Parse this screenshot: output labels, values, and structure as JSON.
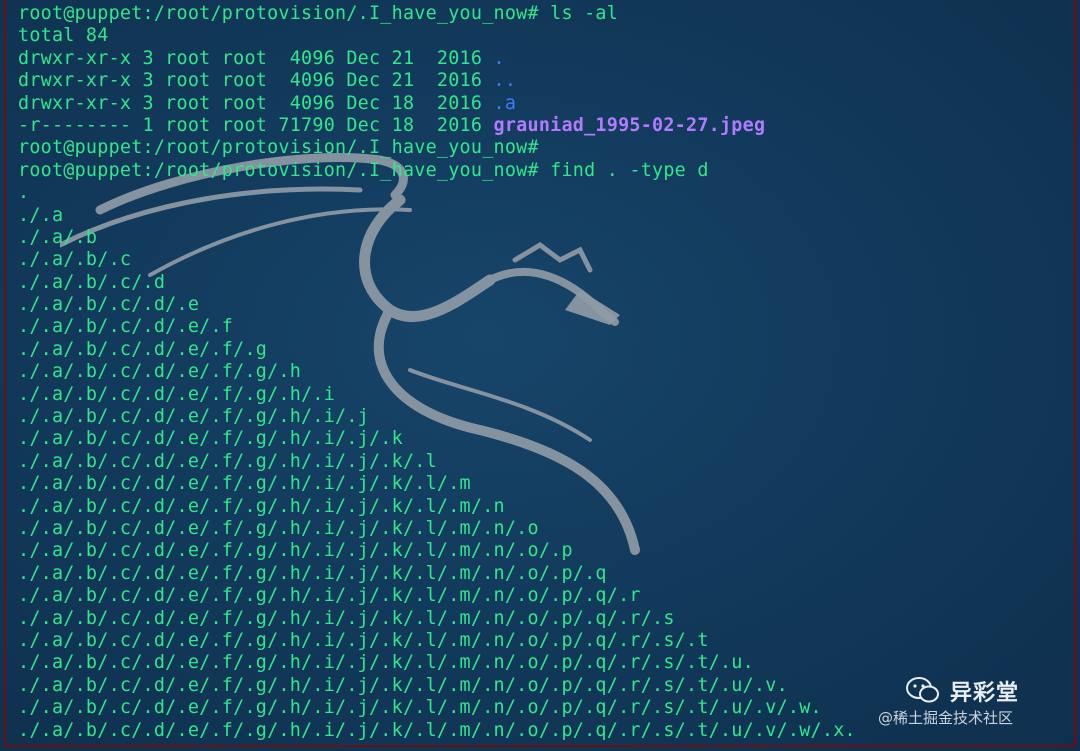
{
  "terminal": {
    "lines": [
      {
        "text": "root@puppet:/root/protovision/.I_have_you_now# ls -al"
      },
      {
        "text": "total 84"
      },
      {
        "text": "drwxr-xr-x 3 root root  4096 Dec 21  2016 ",
        "name": ".",
        "color": "#3d7dff"
      },
      {
        "text": "drwxr-xr-x 3 root root  4096 Dec 21  2016 ",
        "name": "..",
        "color": "#3d7dff"
      },
      {
        "text": "drwxr-xr-x 3 root root  4096 Dec 18  2016 ",
        "name": ".a",
        "color": "#3d7dff"
      },
      {
        "text": "-r-------- 1 root root 71790 Dec 18  2016 ",
        "name": "grauniad_1995-02-27.jpeg",
        "color": "#b27bff"
      },
      {
        "text": "root@puppet:/root/protovision/.I_have_you_now#"
      },
      {
        "text": "root@puppet:/root/protovision/.I_have_you_now# find . -type d"
      },
      {
        "text": "."
      },
      {
        "text": "./.a"
      },
      {
        "text": "./.a/.b"
      },
      {
        "text": "./.a/.b/.c"
      },
      {
        "text": "./.a/.b/.c/.d"
      },
      {
        "text": "./.a/.b/.c/.d/.e"
      },
      {
        "text": "./.a/.b/.c/.d/.e/.f"
      },
      {
        "text": "./.a/.b/.c/.d/.e/.f/.g"
      },
      {
        "text": "./.a/.b/.c/.d/.e/.f/.g/.h"
      },
      {
        "text": "./.a/.b/.c/.d/.e/.f/.g/.h/.i"
      },
      {
        "text": "./.a/.b/.c/.d/.e/.f/.g/.h/.i/.j"
      },
      {
        "text": "./.a/.b/.c/.d/.e/.f/.g/.h/.i/.j/.k"
      },
      {
        "text": "./.a/.b/.c/.d/.e/.f/.g/.h/.i/.j/.k/.l"
      },
      {
        "text": "./.a/.b/.c/.d/.e/.f/.g/.h/.i/.j/.k/.l/.m"
      },
      {
        "text": "./.a/.b/.c/.d/.e/.f/.g/.h/.i/.j/.k/.l/.m/.n"
      },
      {
        "text": "./.a/.b/.c/.d/.e/.f/.g/.h/.i/.j/.k/.l/.m/.n/.o"
      },
      {
        "text": "./.a/.b/.c/.d/.e/.f/.g/.h/.i/.j/.k/.l/.m/.n/.o/.p"
      },
      {
        "text": "./.a/.b/.c/.d/.e/.f/.g/.h/.i/.j/.k/.l/.m/.n/.o/.p/.q"
      },
      {
        "text": "./.a/.b/.c/.d/.e/.f/.g/.h/.i/.j/.k/.l/.m/.n/.o/.p/.q/.r"
      },
      {
        "text": "./.a/.b/.c/.d/.e/.f/.g/.h/.i/.j/.k/.l/.m/.n/.o/.p/.q/.r/.s"
      },
      {
        "text": "./.a/.b/.c/.d/.e/.f/.g/.h/.i/.j/.k/.l/.m/.n/.o/.p/.q/.r/.s/.t"
      },
      {
        "text": "./.a/.b/.c/.d/.e/.f/.g/.h/.i/.j/.k/.l/.m/.n/.o/.p/.q/.r/.s/.t/.u."
      },
      {
        "text": "./.a/.b/.c/.d/.e/.f/.g/.h/.i/.j/.k/.l/.m/.n/.o/.p/.q/.r/.s/.t/.u/.v."
      },
      {
        "text": "./.a/.b/.c/.d/.e/.f/.g/.h/.i/.j/.k/.l/.m/.n/.o/.p/.q/.r/.s/.t/.u/.v/.w."
      },
      {
        "text": "./.a/.b/.c/.d/.e/.f/.g/.h/.i/.j/.k/.l/.m/.n/.o/.p/.q/.r/.s/.t/.u/.v/.w/.x."
      }
    ]
  },
  "watermark": {
    "brand": "异彩堂",
    "sub": "@稀土掘金技术社区",
    "icon": "wechat-icon"
  },
  "colors": {
    "prompt_green": "#2ee88a",
    "dir_blue": "#3d7dff",
    "file_purple": "#b27bff",
    "background": "#123a5c"
  },
  "background_logo": "kali-dragon-icon"
}
